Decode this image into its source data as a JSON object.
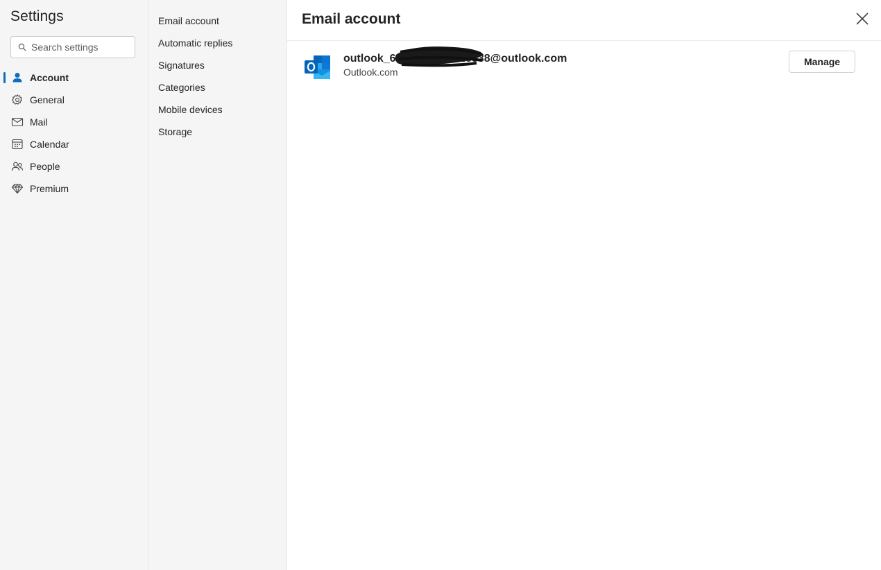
{
  "settings": {
    "title": "Settings",
    "search_placeholder": "Search settings",
    "search_value": ""
  },
  "nav": {
    "items": [
      {
        "label": "Account",
        "icon": "person-icon",
        "active": true
      },
      {
        "label": "General",
        "icon": "gear-icon",
        "active": false
      },
      {
        "label": "Mail",
        "icon": "mail-icon",
        "active": false
      },
      {
        "label": "Calendar",
        "icon": "calendar-icon",
        "active": false
      },
      {
        "label": "People",
        "icon": "people-icon",
        "active": false
      },
      {
        "label": "Premium",
        "icon": "diamond-icon",
        "active": false
      }
    ]
  },
  "subnav": {
    "items": [
      {
        "label": "Email account"
      },
      {
        "label": "Automatic replies"
      },
      {
        "label": "Signatures"
      },
      {
        "label": "Categories"
      },
      {
        "label": "Mobile devices"
      },
      {
        "label": "Storage"
      }
    ]
  },
  "main": {
    "title": "Email account",
    "account": {
      "email": "outlook_6562A7FFCCE5838@outlook.com",
      "type": "Outlook.com",
      "manage_label": "Manage"
    }
  },
  "colors": {
    "accent": "#0f6cbd",
    "pane_background": "#f5f5f5",
    "outlook_blue": "#0364b8"
  }
}
